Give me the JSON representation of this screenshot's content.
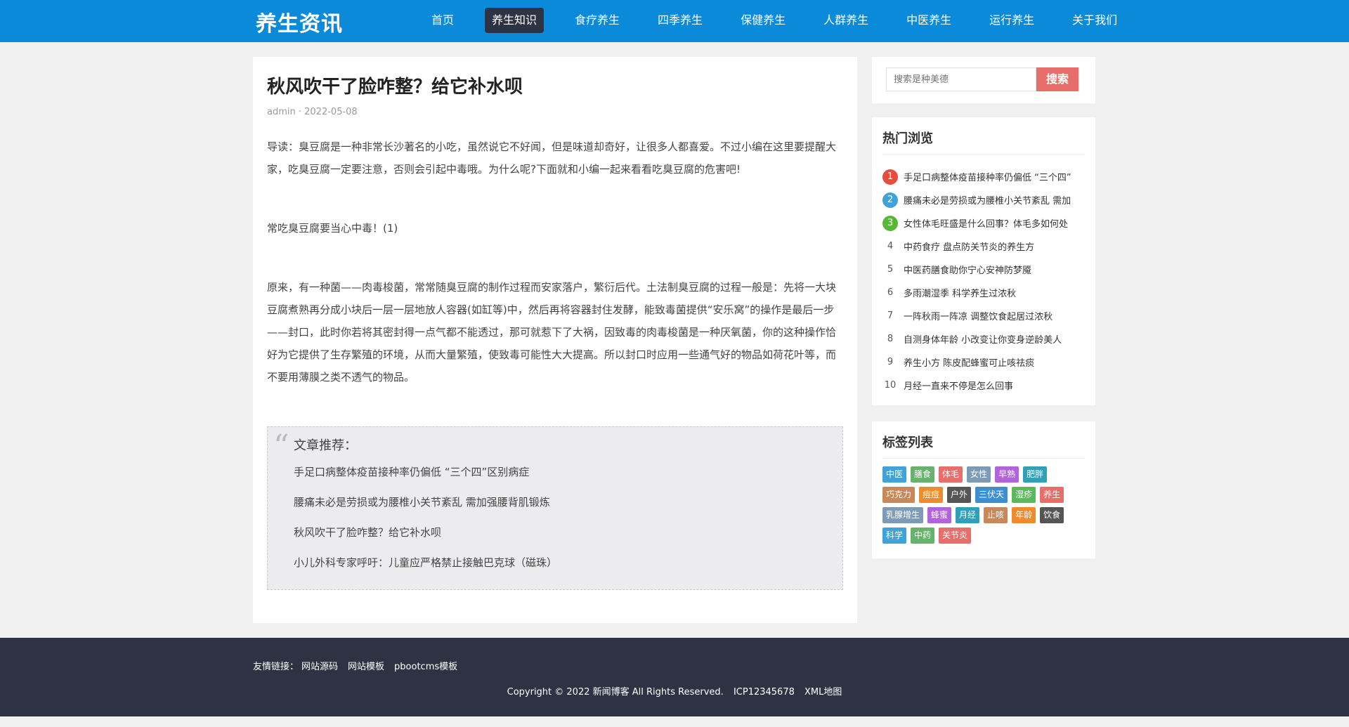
{
  "header": {
    "logo": "养生资讯",
    "nav": [
      "首页",
      "养生知识",
      "食疗养生",
      "四季养生",
      "保健养生",
      "人群养生",
      "中医养生",
      "运行养生",
      "关于我们"
    ],
    "active_index": 1
  },
  "article": {
    "title": "秋风吹干了脸咋整？给它补水呗",
    "author": "admin",
    "separator": "·",
    "date": "2022-05-08",
    "paragraphs": [
      "导读：臭豆腐是一种非常长沙著名的小吃，虽然说它不好闻，但是味道却奇好，让很多人都喜爱。不过小编在这里要提醒大家，吃臭豆腐一定要注意，否则会引起中毒哦。为什么呢?下面就和小编一起来看看吃臭豆腐的危害吧!",
      "常吃臭豆腐要当心中毒！(1)",
      "原来，有一种菌——肉毒梭菌，常常随臭豆腐的制作过程而安家落户，繁衍后代。土法制臭豆腐的过程一般是：先将一大块豆腐煮熟再分成小块后一层一层地放人容器(如缸等)中，然后再将容器封住发酵，能致毒菌提供“安乐窝”的操作是最后一步——封口，此时你若将其密封得一点气都不能透过，那可就惹下了大祸，因致毒的肉毒梭菌是一种厌氧菌，你的这种操作恰好为它提供了生存繁殖的环境，从而大量繁殖，使致毒可能性大大提高。所以封口时应用一些通气好的物品如荷花叶等，而不要用薄膜之类不透气的物品。"
    ]
  },
  "recommend": {
    "quote_mark": "“",
    "heading": "文章推荐：",
    "items": [
      "手足口病整体疫苗接种率仍偏低 “三个四”区别病症",
      "腰痛未必是劳损或为腰椎小关节紊乱 需加强腰背肌锻炼",
      "秋风吹干了脸咋整？给它补水呗",
      "小儿外科专家呼吁：儿童应严格禁止接触巴克球（磁珠）"
    ]
  },
  "search": {
    "placeholder": "搜索是种美德",
    "button": "搜索"
  },
  "hot": {
    "title": "热门浏览",
    "items": [
      {
        "num": "1",
        "text": "手足口病整体疫苗接种率仍偏低 “三个四”"
      },
      {
        "num": "2",
        "text": "腰痛未必是劳损或为腰椎小关节紊乱 需加"
      },
      {
        "num": "3",
        "text": "女性体毛旺盛是什么回事？体毛多如何处"
      },
      {
        "num": "4",
        "text": "中药食疗 盘点防关节炎的养生方"
      },
      {
        "num": "5",
        "text": "中医药膳食助你宁心安神防梦魇"
      },
      {
        "num": "6",
        "text": "多雨潮湿季 科学养生过浓秋"
      },
      {
        "num": "7",
        "text": "一阵秋雨一阵凉 调整饮食起居过浓秋"
      },
      {
        "num": "8",
        "text": "自测身体年龄 小改变让你变身逆龄美人"
      },
      {
        "num": "9",
        "text": "养生小方 陈皮配蜂蜜可止咳祛痰"
      },
      {
        "num": "10",
        "text": "月经一直来不停是怎么回事"
      }
    ]
  },
  "tags": {
    "title": "标签列表",
    "items": [
      {
        "label": "中医",
        "color": "#3fa3d9"
      },
      {
        "label": "膳食",
        "color": "#68b36b"
      },
      {
        "label": "体毛",
        "color": "#e76e6a"
      },
      {
        "label": "女性",
        "color": "#7e9bb5"
      },
      {
        "label": "早熟",
        "color": "#b263d9"
      },
      {
        "label": "肥胖",
        "color": "#2fa0b8"
      },
      {
        "label": "巧克力",
        "color": "#c9885a"
      },
      {
        "label": "痘痘",
        "color": "#ee8c2c"
      },
      {
        "label": "户外",
        "color": "#555555"
      },
      {
        "label": "三伏天",
        "color": "#3d8fd0"
      },
      {
        "label": "湿疹",
        "color": "#5cb85c"
      },
      {
        "label": "养生",
        "color": "#e76e6a"
      },
      {
        "label": "乳腺增生",
        "color": "#7e9bb5"
      },
      {
        "label": "蜂蜜",
        "color": "#b263d9"
      },
      {
        "label": "月经",
        "color": "#2fa0b8"
      },
      {
        "label": "止咳",
        "color": "#c9885a"
      },
      {
        "label": "年龄",
        "color": "#ee8c2c"
      },
      {
        "label": "饮食",
        "color": "#555555"
      },
      {
        "label": "科学",
        "color": "#3fa3d9"
      },
      {
        "label": "中药",
        "color": "#68b36b"
      },
      {
        "label": "关节炎",
        "color": "#e76e6a"
      }
    ]
  },
  "footer": {
    "links_label": "友情链接：",
    "links": [
      "网站源码",
      "网站模板",
      "pbootcms模板"
    ],
    "copyright": "Copyright © 2022 新闻博客 All Rights Reserved.",
    "icp": "ICP12345678",
    "sitemap": "XML地图"
  },
  "colors": {
    "header_bg": "#0a8ad8",
    "nav_active_bg": "#2d3342",
    "footer_bg": "#2d3342",
    "search_button": "#e76e6a"
  }
}
